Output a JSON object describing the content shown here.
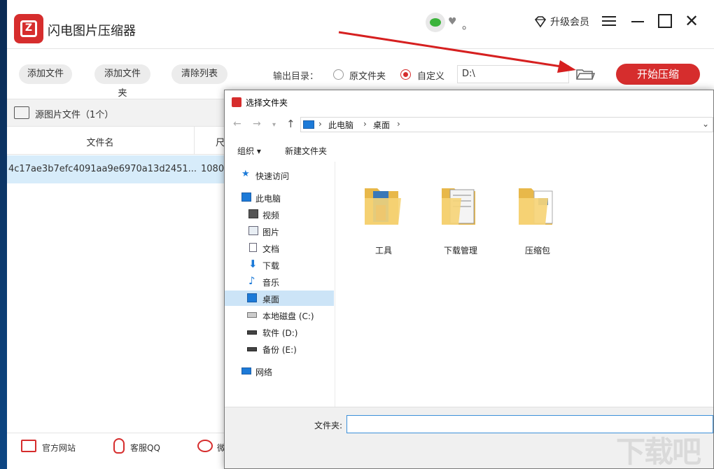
{
  "app": {
    "title": "闪电图片压缩器",
    "dot": "。",
    "vip_label": "升级会员"
  },
  "toolbar": {
    "add_file": "添加文件",
    "add_folder": "添加文件夹",
    "clear_list": "清除列表",
    "output_label": "输出目录：",
    "radio_original": "原文件夹",
    "radio_custom": "自定义",
    "radio_selected": "custom",
    "output_path": "D:\\",
    "start": "开始压缩"
  },
  "file_list": {
    "section_label": "源图片文件（1个）",
    "columns": [
      "文件名",
      "尺"
    ],
    "rows": [
      {
        "name": "4c17ae3b7efc4091aa9e6970a13d2451....",
        "size": "1080"
      }
    ]
  },
  "bottom": {
    "website": "官方网站",
    "qq": "客服QQ",
    "wechat": "微"
  },
  "dialog": {
    "title": "选择文件夹",
    "breadcrumb": [
      "此电脑",
      "桌面"
    ],
    "organize": "组织 ▾",
    "new_folder": "新建文件夹",
    "nav": {
      "quick_access": "快速访问",
      "this_pc": "此电脑",
      "videos": "视频",
      "pictures": "图片",
      "documents": "文档",
      "downloads": "下载",
      "music": "音乐",
      "desktop": "桌面",
      "local_c": "本地磁盘 (C:)",
      "soft_d": "软件 (D:)",
      "backup_e": "备份 (E:)",
      "network": "网络"
    },
    "folders": [
      "工具",
      "下载管理",
      "压缩包"
    ],
    "folder_field_label": "文件夹:",
    "folder_field_value": ""
  },
  "colors": {
    "brand_red": "#d62d2d",
    "selection_blue": "#d7ecfa",
    "nav_selected": "#cce4f7"
  },
  "watermark": "下载吧"
}
